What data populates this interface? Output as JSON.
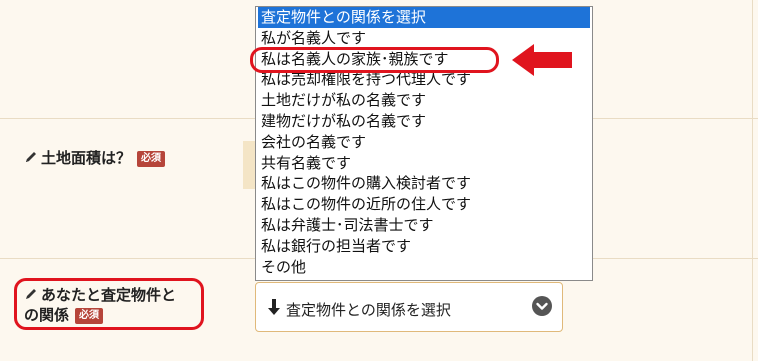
{
  "form": {
    "land_area_label": "土地面積は？",
    "relation_label_line1": "あなたと査定物件と",
    "relation_label_line2": "の関係",
    "required_badge": "必須"
  },
  "select": {
    "current_value": "査定物件との関係を選択"
  },
  "dropdown": {
    "options": [
      "査定物件との関係を選択",
      "私が名義人です",
      "私は名義人の家族･親族です",
      "私は売却権限を持つ代理人です",
      "土地だけが私の名義です",
      "建物だけが私の名義です",
      "会社の名義です",
      "共有名義です",
      "私はこの物件の購入検討者です",
      "私はこの物件の近所の住人です",
      "私は弁護士･司法書士です",
      "私は銀行の担当者です",
      "その他"
    ],
    "selected_index": 0,
    "highlighted_index": 2
  },
  "colors": {
    "accent_selected": "#1e73d8",
    "annotation_red": "#e0141e",
    "badge_red": "#b6453a",
    "page_bg": "#fdf8ef"
  },
  "icons": {
    "field_label": "pencil-icon",
    "select_prefix": "arrow-down-icon",
    "select_toggle": "chevron-down-circle-icon",
    "annotation": "red-arrow-left-icon"
  }
}
